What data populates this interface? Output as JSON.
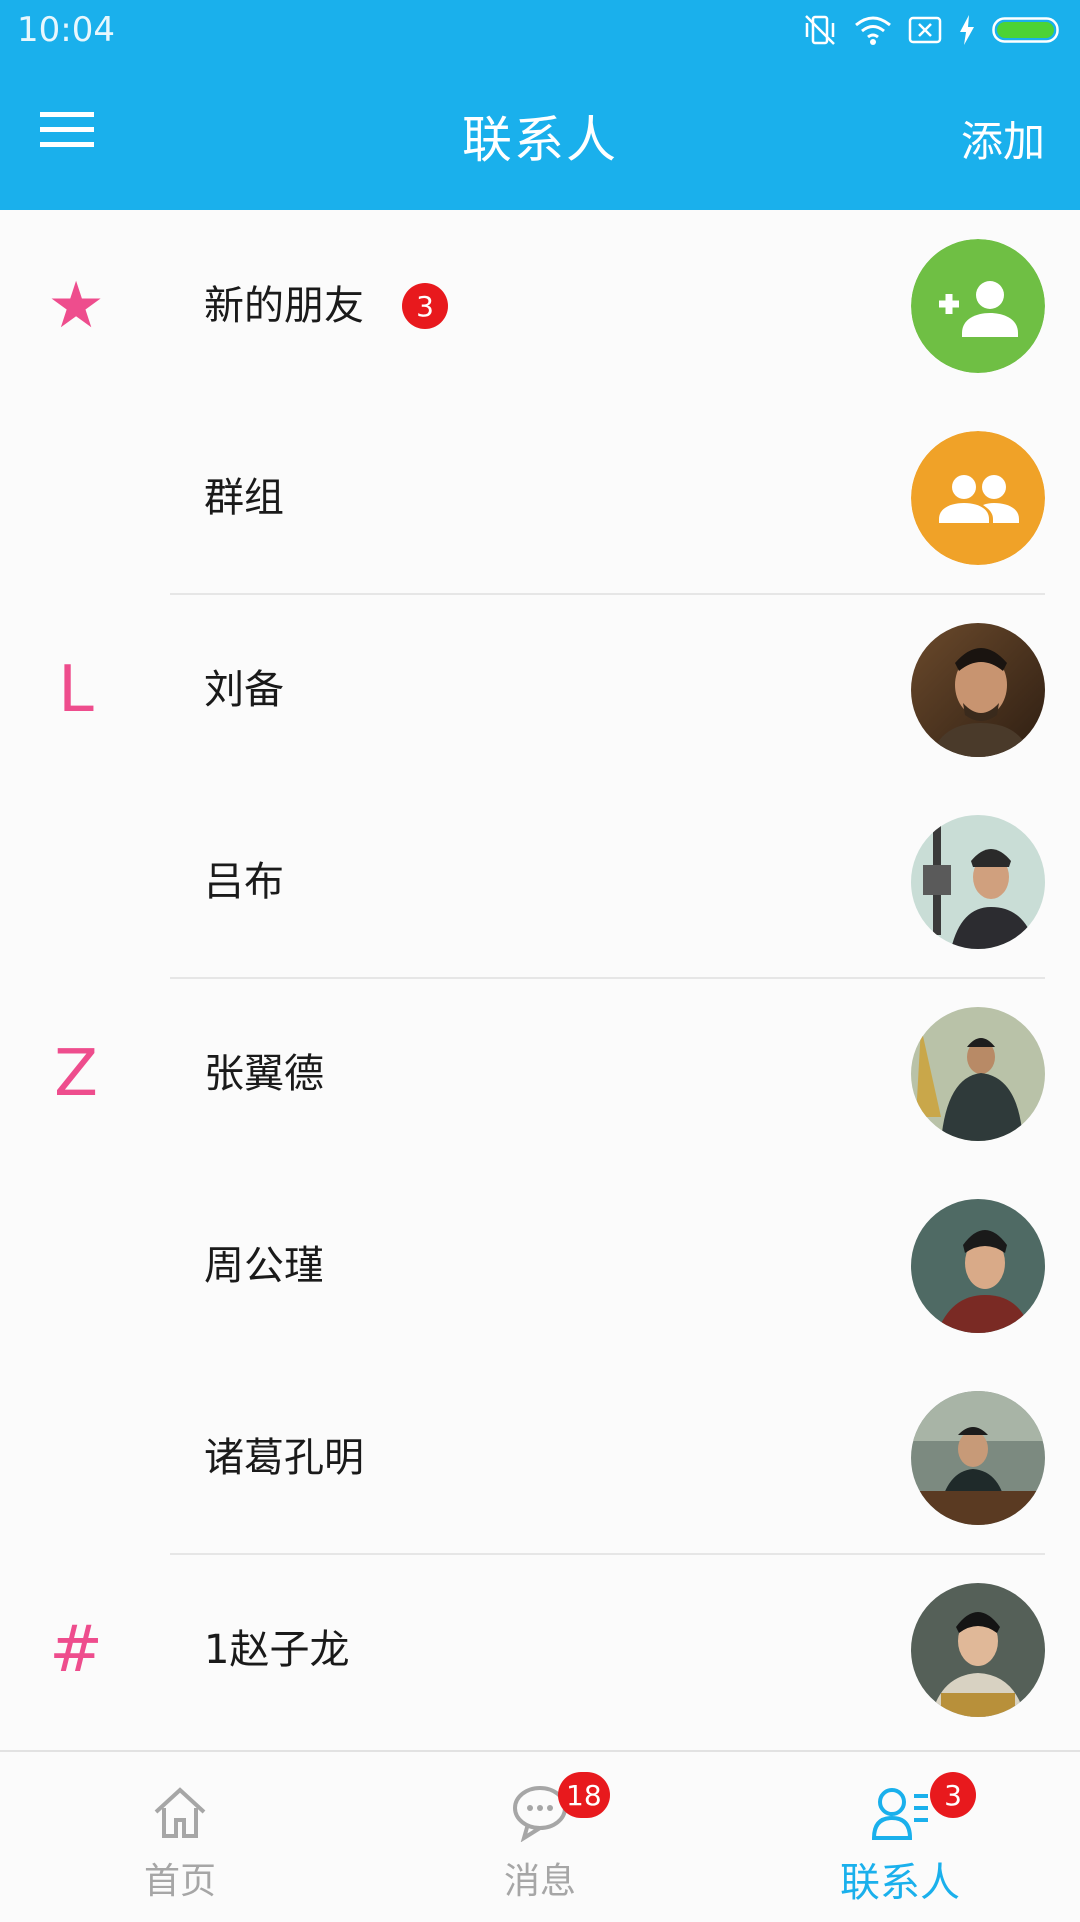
{
  "status_bar": {
    "time": "10:04"
  },
  "app_bar": {
    "title": "联系人",
    "action_label": "添加"
  },
  "colors": {
    "primary": "#1ab0ec",
    "index_letter": "#ee4d8d",
    "badge": "#e8191d",
    "new_friend_icon_bg": "#6fbf44",
    "group_icon_bg": "#f0a228"
  },
  "contacts": [
    {
      "index": "★",
      "name": "新的朋友",
      "badge": "3",
      "avatar": "add-person-icon"
    },
    {
      "index": "",
      "name": "群组",
      "avatar": "group-icon"
    },
    {
      "index": "L",
      "name": "刘备",
      "avatar": "photo"
    },
    {
      "index": "",
      "name": "吕布",
      "avatar": "photo"
    },
    {
      "index": "Z",
      "name": "张翼德",
      "avatar": "photo"
    },
    {
      "index": "",
      "name": "周公瑾",
      "avatar": "photo"
    },
    {
      "index": "",
      "name": "诸葛孔明",
      "avatar": "photo"
    },
    {
      "index": "#",
      "name": "1赵子龙",
      "avatar": "photo"
    }
  ],
  "bottom_nav": [
    {
      "label": "首页",
      "icon": "home-icon",
      "active": false
    },
    {
      "label": "消息",
      "icon": "chat-icon",
      "badge": "18",
      "active": false
    },
    {
      "label": "联系人",
      "icon": "contacts-icon",
      "badge": "3",
      "active": true
    }
  ]
}
